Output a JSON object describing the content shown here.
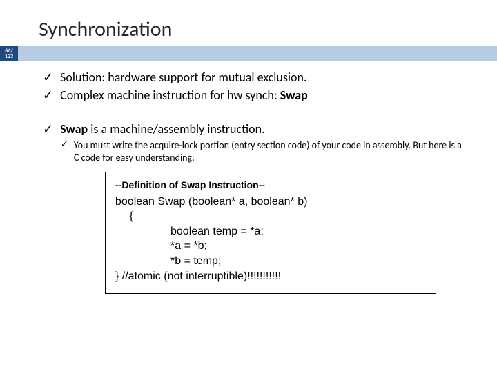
{
  "title": "Synchronization",
  "page": {
    "num": "66/",
    "den": "123"
  },
  "bullets": {
    "b1": "Solution: hardware support for mutual exclusion.",
    "b2_pre": "Complex machine instruction for hw synch: ",
    "b2_bold": "Swap",
    "b3_bold": "Swap",
    "b3_rest": " is a machine/assembly instruction.",
    "sub1": "You must write the acquire-lock portion (entry section code) of your code in assembly. But here is a C code for easy understanding:"
  },
  "codebox": {
    "header": "--Definition of Swap Instruction--",
    "l1": "boolean Swap (boolean* a, boolean* b)",
    "l2": " {",
    "l3": "boolean temp = *a;",
    "l4": "*a = *b;",
    "l5": "*b = temp;",
    "l6": "} //atomic (not interruptible)!!!!!!!!!!!"
  }
}
